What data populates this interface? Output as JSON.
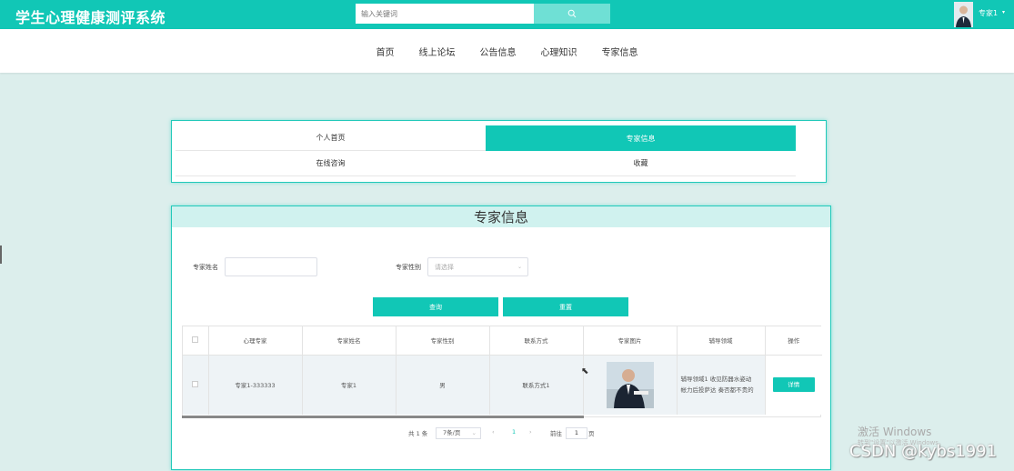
{
  "header": {
    "app_title": "学生心理健康测评系统",
    "search_placeholder": "输入关键词",
    "search_icon": "search-icon",
    "username": "专家1",
    "user_caret": "▾"
  },
  "nav": {
    "items": [
      "首页",
      "线上论坛",
      "公告信息",
      "心理知识",
      "专家信息"
    ]
  },
  "tabs": {
    "personal_home": "个人首页",
    "expert_info": "专家信息",
    "online_consult": "在线咨询",
    "favorites": "收藏"
  },
  "panel": {
    "title": "专家信息",
    "filters": {
      "name_label": "专家姓名",
      "gender_label": "专家性别",
      "gender_placeholder": "请选择"
    },
    "buttons": {
      "query": "查询",
      "reset": "重置"
    },
    "table": {
      "headers": [
        "心理专家",
        "专家姓名",
        "专家性别",
        "联系方式",
        "专家图片",
        "辅导领域",
        "操作"
      ],
      "rows": [
        {
          "account": "专家1-333333",
          "name": "专家1",
          "gender": "男",
          "contact": "联系方式1",
          "area_line1": "辅导领域1 收见防器水姿动",
          "area_line2": "帐力后投萨达 奏否都不贵的",
          "action": "详情"
        }
      ]
    },
    "pagination": {
      "total": "共 1 条",
      "page_size": "7条/页",
      "prev": "‹",
      "current": "1",
      "next": "›",
      "goto_label": "前往",
      "goto_value": "1",
      "page_suffix": "页"
    }
  },
  "watermark": {
    "activate": "激活 Windows",
    "activate_sub": "转到\"设置\"以激活 Windows。",
    "csdn": "CSDN @kybs1991"
  }
}
